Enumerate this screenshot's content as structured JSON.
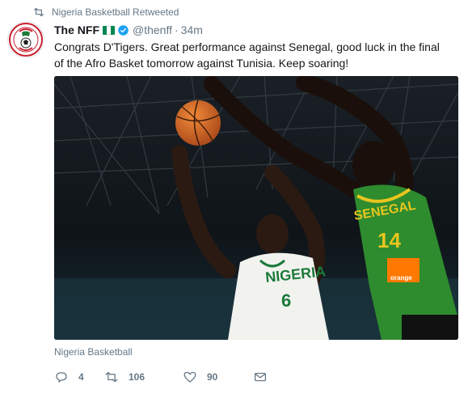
{
  "retweet_context": {
    "icon": "retweet-icon",
    "text": "Nigeria Basketball Retweeted"
  },
  "author": {
    "display_name": "The NFF",
    "flag": {
      "name": "nigeria-flag",
      "colors": [
        "#008751",
        "#ffffff",
        "#008751"
      ]
    },
    "verified_icon": "verified-badge-icon",
    "handle": "@thenff",
    "separator": "·",
    "timestamp": "34m",
    "avatar_icon": "nff-logo"
  },
  "tweet": {
    "text": "Congrats D'Tigers. Great performance against Senegal, good luck in the final of the Afro Basket tomorrow against Tunisia. Keep soaring!"
  },
  "media": {
    "type": "photo",
    "jersey_nigeria": {
      "text": "NIGERIA",
      "number": "6"
    },
    "jersey_senegal": {
      "text": "SENEGAL",
      "number": "14",
      "sponsor": "orange"
    },
    "source_label": "Nigeria Basketball"
  },
  "actions": {
    "reply": {
      "icon": "reply-icon",
      "count": "4"
    },
    "retweet": {
      "icon": "retweet-icon",
      "count": "106"
    },
    "like": {
      "icon": "heart-icon",
      "count": "90"
    },
    "dm": {
      "icon": "envelope-icon"
    }
  },
  "colors": {
    "secondary_text": "#657786",
    "verified": "#1da1f2",
    "nigeria_green": "#008751",
    "senegal_green": "#2e8b2e",
    "senegal_yellow": "#e8c51e",
    "orange_brand": "#ff7900"
  }
}
